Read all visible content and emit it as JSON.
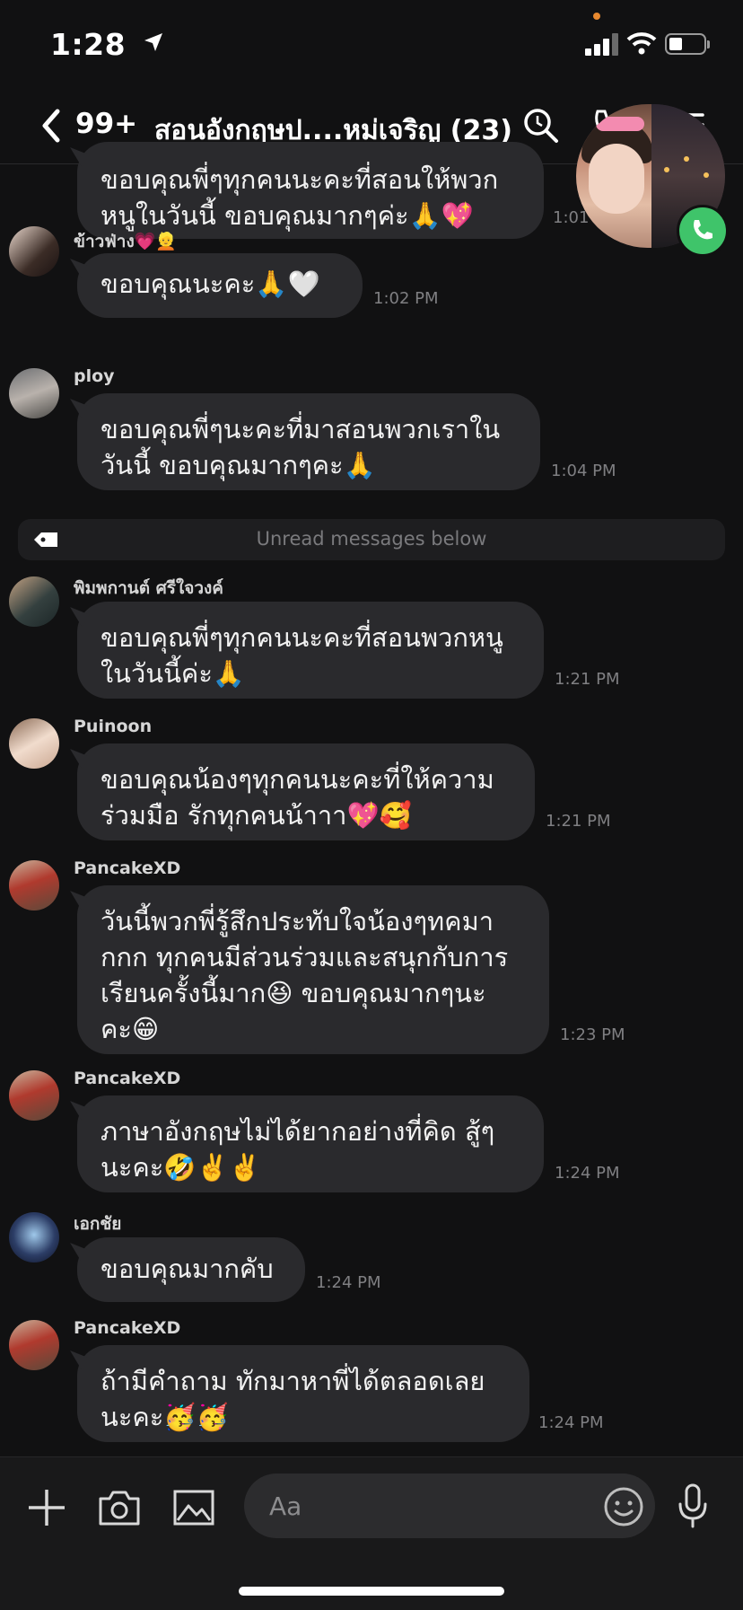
{
  "status": {
    "time": "1:28"
  },
  "header": {
    "unread_count": "99+",
    "title": "สอนอังกฤษป....หม่เจริญ (23)"
  },
  "unread_divider": "Unread messages below",
  "messages": [
    {
      "sender": "",
      "text": "ขอบคุณพี่ๆทุกคนนะคะที่สอนให้พวก\nหนูในวันนี้ ขอบคุณมากๆค่ะ🙏💖",
      "time": "1:01 PM"
    },
    {
      "sender": "ข้าวฟ่าง💗👱",
      "text": "ขอบคุณนะคะ🙏🤍",
      "time": "1:02 PM"
    },
    {
      "sender": "ploy",
      "text": "ขอบคุณพี่ๆนะคะที่มาสอนพวกเราใน\nวันนี้ ขอบคุณมากๆคะ🙏",
      "time": "1:04 PM"
    },
    {
      "sender": "พิมพกานต์ ศรีใจวงค์",
      "text": "ขอบคุณพี่ๆทุกคนนะคะที่สอนพวกหนู\nในวันนี้ค่ะ🙏",
      "time": "1:21 PM"
    },
    {
      "sender": "Puinoon",
      "text": "ขอบคุณน้องๆทุกคนนะคะที่ให้ความ\nร่วมมือ รักทุกคนน้าาา💖🥰",
      "time": "1:21 PM"
    },
    {
      "sender": "PancakeXD",
      "text": "วันนี้พวกพี่รู้สึกประทับใจน้องๆทคมา\nกกก ทุกคนมีส่วนร่วมและสนุกกับการ\nเรียนครั้งนี้มาก😆 ขอบคุณมากๆนะ\nคะ😁",
      "time": "1:23 PM"
    },
    {
      "sender": "PancakeXD",
      "text": "ภาษาอังกฤษไม่ได้ยากอย่างที่คิด สู้ๆ\nนะคะ🤣✌️✌️",
      "time": "1:24 PM"
    },
    {
      "sender": "เอกชัย",
      "text": "ขอบคุณมากคับ",
      "time": "1:24 PM"
    },
    {
      "sender": "PancakeXD",
      "text": "ถ้ามีคำถาม ทักมาหาพี่ได้ตลอดเลย\nนะคะ🥳🥳",
      "time": "1:24 PM"
    }
  ],
  "input": {
    "placeholder": "Aa"
  },
  "icons": [
    "location-arrow-icon",
    "cellular-signal-icon",
    "wifi-icon",
    "battery-icon",
    "back-chevron-icon",
    "search-icon",
    "call-icon",
    "menu-icon",
    "phone-icon",
    "label-tag-icon",
    "plus-icon",
    "camera-icon",
    "image-icon",
    "emoji-icon",
    "microphone-icon"
  ],
  "colors": {
    "background": "#111112",
    "bubble": "#2a2a2d",
    "call_green": "#3fc46a",
    "timestamp": "#7f7f82"
  }
}
